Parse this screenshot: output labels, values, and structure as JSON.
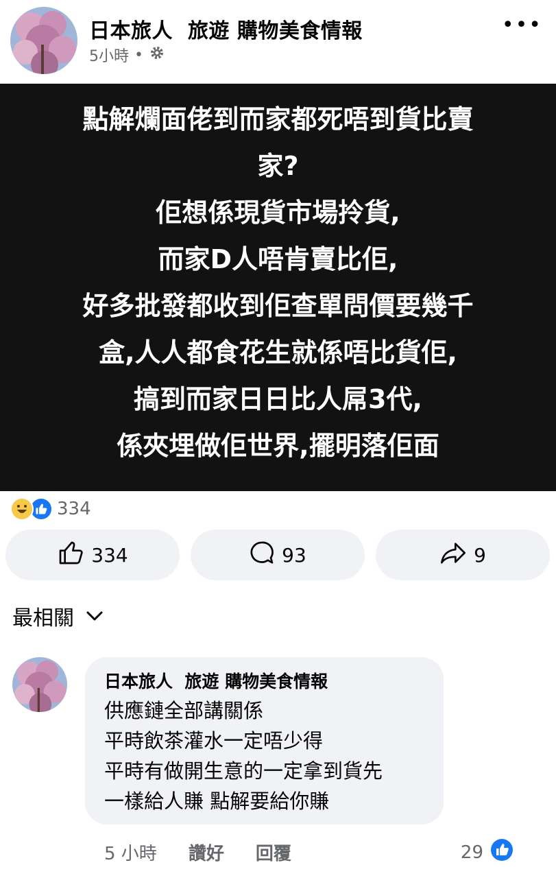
{
  "header": {
    "page_name": "日本旅人  旅遊 購物美食情報",
    "time": "5小時",
    "dot": "•",
    "more": "•••"
  },
  "post": {
    "lines": [
      "點解爛面佬到而家都死唔到貨比賣",
      "家?",
      "佢想係現貨市場拎貨,",
      "而家D人唔肯賣比佢,",
      "好多批發都收到佢查單問價要幾千",
      "盒,人人都食花生就係唔比貨佢,",
      "搞到而家日日比人屌3代,",
      "係夾埋做佢世界,擺明落佢面"
    ]
  },
  "reactions": {
    "count": "334"
  },
  "actions": {
    "like_count": "334",
    "comment_count": "93",
    "share_count": "9"
  },
  "sort": {
    "label": "最相關"
  },
  "comment": {
    "author": "日本旅人  旅遊 購物美食情報",
    "lines": [
      "供應鏈全部講關係",
      "平時飲茶灌水一定唔少得",
      "平時有做開生意的一定拿到貨先",
      "一樣給人賺 點解要給你賺"
    ],
    "time": "5 小時",
    "like_label": "讚好",
    "reply_label": "回覆",
    "like_count": "29"
  }
}
